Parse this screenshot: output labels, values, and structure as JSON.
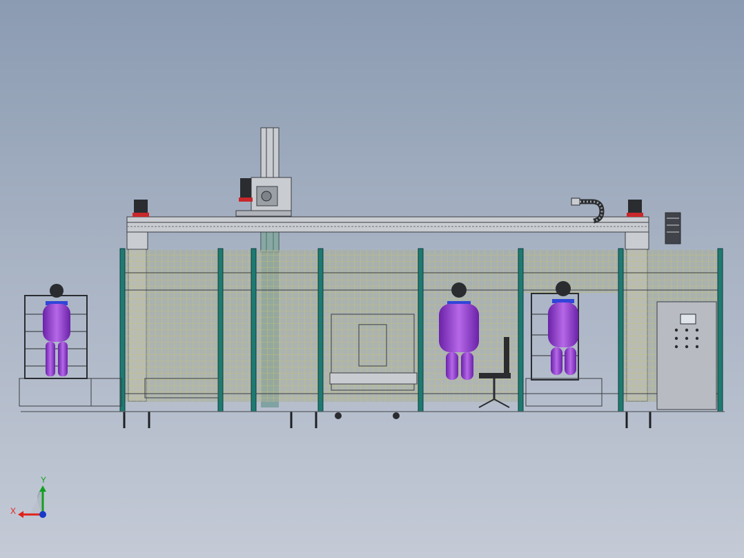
{
  "viewport": {
    "background_top": "#8b9bb2",
    "background_bottom": "#c4cad6"
  },
  "model": {
    "description_hidden": true,
    "colors": {
      "fence_post": "#1e7a72",
      "mesh_line": "#c8c470",
      "mesh_panel_fill": "#a9ae9a",
      "frame_steel": "#c9ccd0",
      "frame_edge": "#3a3d42",
      "manikin": "#8a3fc8",
      "manikin_highlight": "#c07ae8",
      "manikin_collar": "#3045d8",
      "motor_red": "#c8282a",
      "motor_dark": "#2a2c30",
      "cabinet": "#b8bcc2"
    },
    "operators": [
      {
        "id": "operator-left",
        "facing": "front"
      },
      {
        "id": "operator-center-right",
        "facing": "back"
      },
      {
        "id": "operator-right",
        "facing": "back"
      }
    ]
  },
  "triad": {
    "x_label": "X",
    "y_label": "Y",
    "x_color": "#e0201c",
    "y_color": "#10a020",
    "z_color": "#1838c8"
  }
}
